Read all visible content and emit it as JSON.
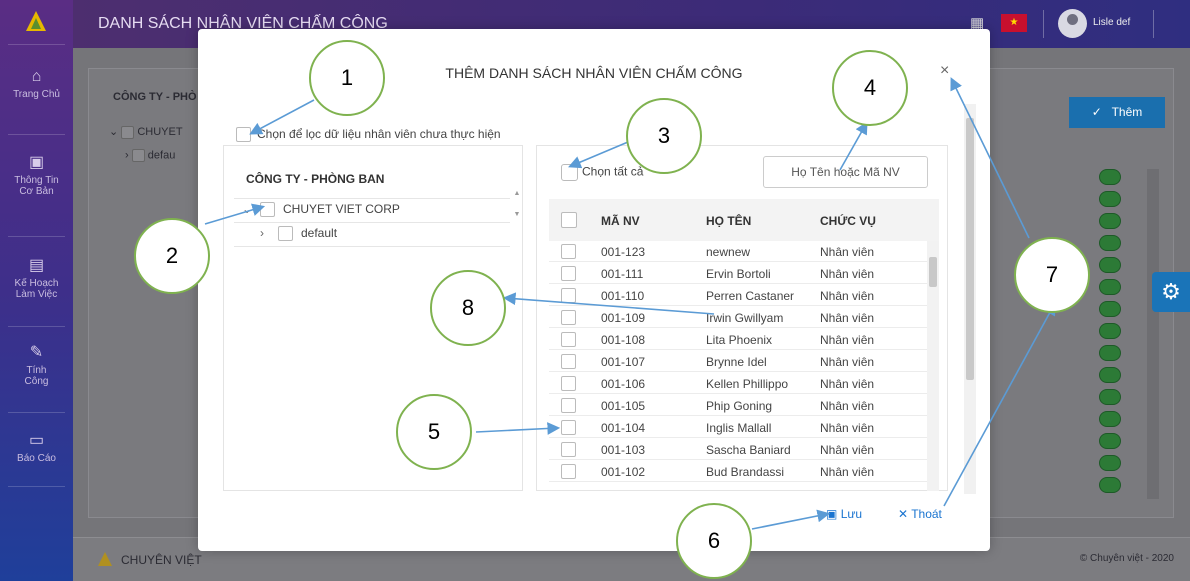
{
  "app": {
    "page_title": "DANH SÁCH NHÂN VIÊN CHẤM CÔNG",
    "user_name": "Lisle def",
    "flag_symbol": "★"
  },
  "sidebar": {
    "items": [
      {
        "label": "Trang Chủ",
        "icon": "home-icon",
        "glyph": "⌂"
      },
      {
        "label": "Thông Tin Cơ Bản",
        "icon": "id-card-icon",
        "glyph": "▣"
      },
      {
        "label": "Kế Hoạch Làm Việc",
        "icon": "briefcase-icon",
        "glyph": "▤"
      },
      {
        "label": "Tính Công",
        "icon": "pencil-icon",
        "glyph": "✎"
      },
      {
        "label": "Báo Cáo",
        "icon": "folder-icon",
        "glyph": "▭"
      }
    ]
  },
  "background": {
    "header": "CÔNG TY - PHÒ",
    "tree_root": "CHUYET",
    "tree_child": "defau",
    "add_button": "Thêm",
    "footer_brand": "CHUYÊN VIỆT",
    "footer_copy": "© Chuyên việt - 2020"
  },
  "modal": {
    "title": "THÊM DANH SÁCH NHÂN VIÊN CHẤM CÔNG",
    "close_glyph": "×",
    "filter_label": "Chọn để lọc dữ liệu nhân viên chưa thực hiện",
    "left_panel": {
      "header": "CÔNG TY - PHÒNG BAN",
      "root_label": "CHUYET VIET CORP",
      "child_label": "default"
    },
    "right_panel": {
      "select_all_label": "Chọn tất cả",
      "search_placeholder": "Họ Tên hoặc Mã NV",
      "columns": {
        "code": "MÃ NV",
        "name": "HỌ TÊN",
        "position": "CHỨC VỤ"
      },
      "rows": [
        {
          "code": "001-123",
          "name": "newnew",
          "position": "Nhân viên"
        },
        {
          "code": "001-111",
          "name": "Ervin Bortoli",
          "position": "Nhân viên"
        },
        {
          "code": "001-110",
          "name": "Perren Castaner",
          "position": "Nhân viên"
        },
        {
          "code": "001-109",
          "name": "Irwin Gwillyam",
          "position": "Nhân viên"
        },
        {
          "code": "001-108",
          "name": "Lita Phoenix",
          "position": "Nhân viên"
        },
        {
          "code": "001-107",
          "name": "Brynne Idel",
          "position": "Nhân viên"
        },
        {
          "code": "001-106",
          "name": "Kellen Phillippo",
          "position": "Nhân viên"
        },
        {
          "code": "001-105",
          "name": "Phip Goning",
          "position": "Nhân viên"
        },
        {
          "code": "001-104",
          "name": "Inglis Mallall",
          "position": "Nhân viên"
        },
        {
          "code": "001-103",
          "name": "Sascha Baniard",
          "position": "Nhân viên"
        },
        {
          "code": "001-102",
          "name": "Bud Brandassi",
          "position": "Nhân viên"
        }
      ]
    },
    "save_label": "Lưu",
    "exit_label": "Thoát"
  },
  "callouts": [
    "1",
    "2",
    "3",
    "4",
    "5",
    "6",
    "7",
    "8"
  ],
  "colors": {
    "accent": "#1a74d0",
    "callout_border": "#7fb24f",
    "arrow": "#5b9bd5"
  }
}
